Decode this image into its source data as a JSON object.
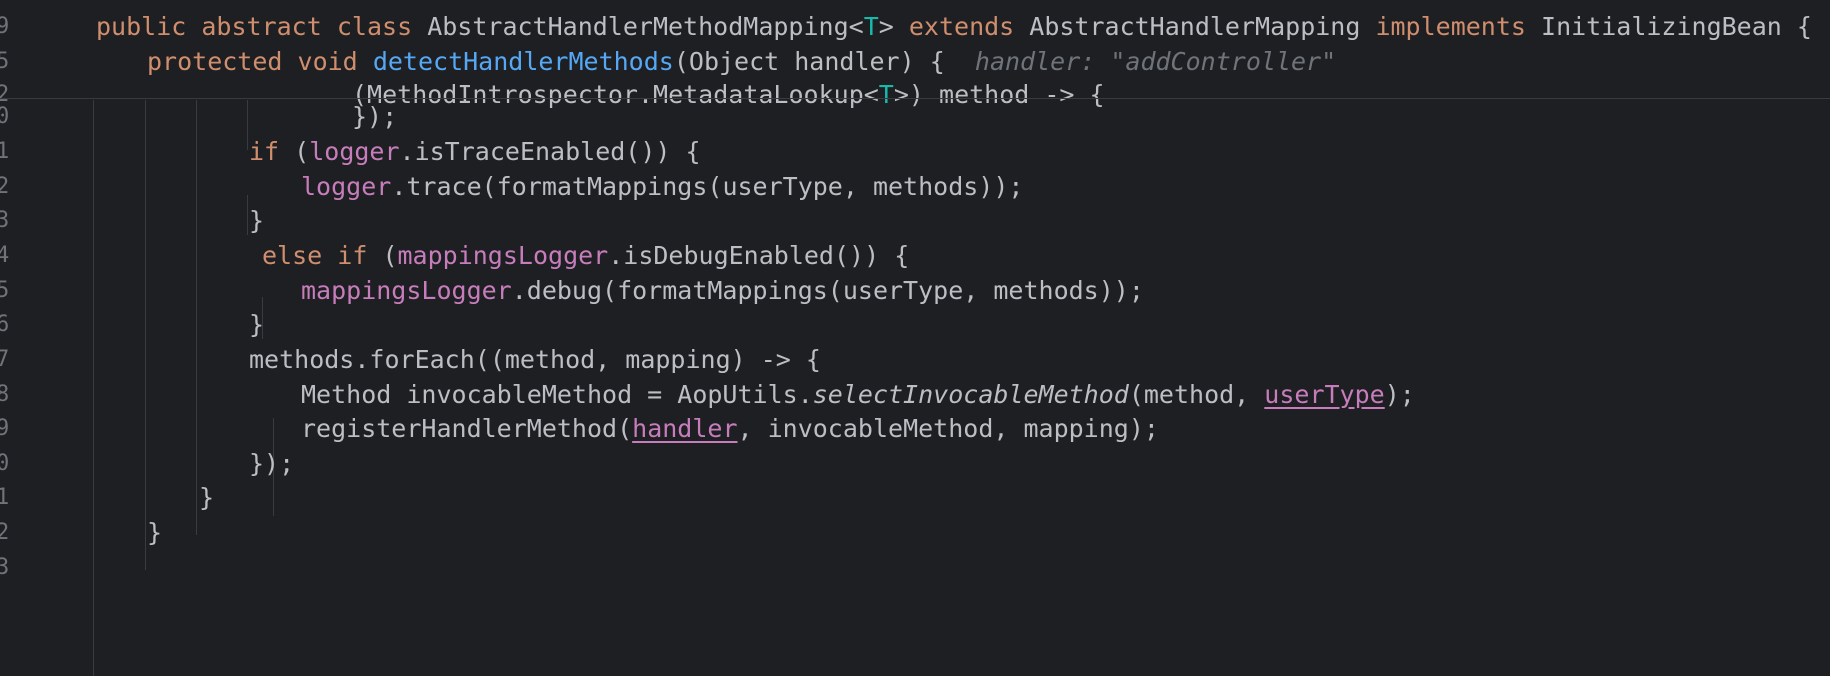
{
  "gutter": [
    "9",
    "5",
    "2",
    "0",
    "1",
    "2",
    "3",
    "4",
    "5",
    "6",
    "7",
    "8",
    "9",
    "0",
    "1",
    "2",
    "3"
  ],
  "sticky": {
    "class_line": {
      "public": "public",
      "abstract": "abstract",
      "class": "class",
      "name": "AbstractHandlerMethodMapping<",
      "type_param": "T",
      "name_close": "> ",
      "extends": "extends",
      "parent": " AbstractHandlerMapping ",
      "implements": "implements",
      "iface": " InitializingBean {"
    },
    "method_line": {
      "protected": "protected",
      "void": "void",
      "method": "detectHandlerMethods",
      "params": "(Object handler) {",
      "hint": "handler: \"addController\""
    },
    "partial_line": {
      "before": "(MethodIntrospector.MetadataLookup<",
      "type": "T",
      "after": ">) method -> {"
    }
  },
  "code": {
    "l0": "});",
    "l1_if": "if",
    "l1_open": " (",
    "l1_logger": "logger",
    "l1_rest": ".isTraceEnabled()) {",
    "l2_logger": "logger",
    "l2_rest": ".trace(formatMappings(userType, methods));",
    "l3": "}",
    "l4_else": "else",
    "l4_if": "if",
    "l4_open": " (",
    "l4_ml": "mappingsLogger",
    "l4_rest": ".isDebugEnabled()) {",
    "l5_ml": "mappingsLogger",
    "l5_rest": ".debug(formatMappings(userType, methods));",
    "l6": "}",
    "l7": "methods.forEach((method, mapping) -> {",
    "l8_a": "Method invocableMethod = AopUtils.",
    "l8_fn": "selectInvocableMethod",
    "l8_b": "(method, ",
    "l8_ut": "userType",
    "l8_c": ");",
    "l9_a": "registerHandlerMethod(",
    "l9_h": "handler",
    "l9_b": ", invocableMethod, mapping);",
    "l10": "});",
    "l11": "}",
    "l12": "}"
  }
}
